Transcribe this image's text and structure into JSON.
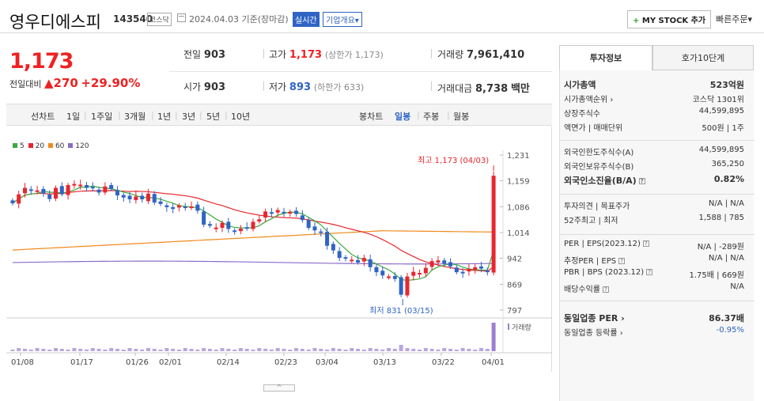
{
  "header": {
    "name": "영우디에스피",
    "code": "143540",
    "market": "코스닥",
    "date": "2024.04.03 기준(장마감)",
    "realtime": "실시간",
    "corp_info": "기업개요▾",
    "mystock": "MY STOCK 추가",
    "mystock_plus": "+",
    "quick_order": "빠른주문▾"
  },
  "quote": {
    "price": "1,173",
    "change_label": "전일대비",
    "change_arrow": "▲",
    "change": "270",
    "change_pct": "+29.90%",
    "prev_label": "전일",
    "prev": "903",
    "open_label": "시가",
    "open": "903",
    "high_label": "고가",
    "high": "1,173",
    "high_note": "(상한가 1,173)",
    "low_label": "저가",
    "low": "893",
    "low_note": "(하한가 633)",
    "volume_label": "거래량",
    "volume": "7,961,410",
    "amount_label": "거래대금",
    "amount": "8,738",
    "amount_unit": "백만"
  },
  "period_tabs": {
    "select_label": "선차트",
    "items": [
      "1일",
      "1주일",
      "3개월",
      "1년",
      "3년",
      "5년",
      "10년"
    ],
    "candle_label": "봉차트",
    "candle_items": [
      "일봉",
      "주봉",
      "월봉"
    ],
    "active_candle": "일봉"
  },
  "legend": [
    "5",
    "20",
    "60",
    "120"
  ],
  "colors": {
    "up": "#e8262f",
    "down": "#2f64c4",
    "ma5": "#3daa3d",
    "ma20": "#e8262f",
    "ma60": "#f08a1c",
    "ma120": "#8a6cc9"
  },
  "chart_data": {
    "type": "candlestick",
    "y_ticks": [
      "1,231",
      "1,159",
      "1,086",
      "1,014",
      "942",
      "869",
      "797"
    ],
    "ylim": [
      797,
      1231
    ],
    "x_ticks": [
      "01/08",
      "01/17",
      "01/26",
      "02/01",
      "02/14",
      "02/23",
      "03/04",
      "03/13",
      "03/22",
      "04/01"
    ],
    "max_label": "최고 1,173 (04/03)",
    "min_label": "최저 831 (03/15)",
    "volume_label": "거래량",
    "close": [
      1096,
      1121,
      1139,
      1131,
      1132,
      1123,
      1108,
      1139,
      1121,
      1147,
      1150,
      1148,
      1139,
      1138,
      1126,
      1143,
      1136,
      1118,
      1112,
      1107,
      1115,
      1107,
      1123,
      1098,
      1094,
      1085,
      1080,
      1090,
      1085,
      1087,
      1075,
      1036,
      1033,
      1028,
      1041,
      1024,
      1018,
      1025,
      1027,
      1044,
      1051,
      1073,
      1068,
      1077,
      1068,
      1072,
      1066,
      1049,
      1027,
      1020,
      1015,
      977,
      964,
      943,
      941,
      938,
      930,
      943,
      917,
      903,
      894,
      891,
      884,
      840,
      891,
      904,
      901,
      915,
      934,
      936,
      927,
      919,
      903,
      900,
      912,
      917,
      913,
      903,
      1173
    ]
  },
  "panel": {
    "tab_info": "투자정보",
    "tab_hoga": "호가10단계",
    "rows": [
      {
        "l": "시가총액",
        "r": "523억원",
        "bold": true
      },
      {
        "l": "시가총액순위 ›",
        "r": "코스닥 1301위"
      },
      {
        "l": "상장주식수",
        "r": "44,599,895"
      },
      {
        "l": "액면가 | 매매단위",
        "r": "500원 | 1주"
      },
      {
        "l": "외국인한도주식수(A)",
        "r": "44,599,895"
      },
      {
        "l": "외국인보유주식수(B)",
        "r": "365,250"
      },
      {
        "l": "외국인소진율(B/A)",
        "r": "0.82%",
        "bold": true,
        "q": true
      },
      {
        "l": "투자의견 | 목표주가",
        "r": "N/A | N/A"
      },
      {
        "l": "52주최고 | 최저",
        "r": "1,588 | 785"
      },
      {
        "l": "PER | EPS(2023.12)",
        "r": "N/A | -289원",
        "q": true
      },
      {
        "l": "추정PER | EPS",
        "r": "N/A | N/A",
        "q": true
      },
      {
        "l": "PBR | BPS (2023.12)",
        "r": "1.75배 | 669원",
        "q": true
      },
      {
        "l": "배당수익률",
        "r": "N/A",
        "q": true
      },
      {
        "l": "동일업종 PER ›",
        "r": "86.37배",
        "bold": true
      },
      {
        "l": "동일업종 등락률 ›",
        "r": "-0.95%",
        "blue": true
      }
    ]
  }
}
